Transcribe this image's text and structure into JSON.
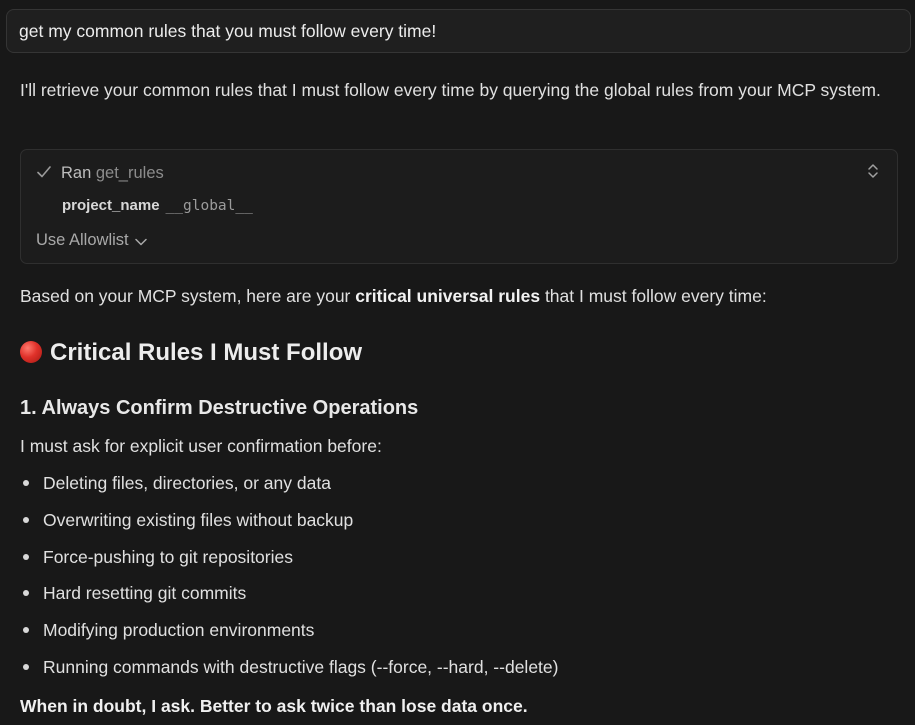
{
  "user_prompt": "get my common rules that you must follow every time!",
  "intro_text": "I'll retrieve your common rules that I must follow every time by querying the global rules from your MCP system.",
  "tool_call": {
    "status_label": "Ran",
    "tool_name": "get_rules",
    "param_key": "project_name",
    "param_value": "__global__",
    "allowlist_label": "Use Allowlist"
  },
  "summary": {
    "before": "Based on your MCP system, here are your ",
    "bold": "critical universal rules",
    "after": " that I must follow every time:"
  },
  "heading": "Critical Rules I Must Follow",
  "rule1": {
    "title": "1. Always Confirm Destructive Operations",
    "lead": "I must ask for explicit user confirmation before:",
    "bullets": [
      "Deleting files, directories, or any data",
      "Overwriting existing files without backup",
      "Force-pushing to git repositories",
      "Hard resetting git commits",
      "Modifying production environments",
      "Running commands with destructive flags (--force, --hard, --delete)"
    ],
    "closing": "When in doubt, I ask. Better to ask twice than lose data once."
  },
  "icons": {
    "status": "checkmark-icon",
    "expand": "expand-collapse-icon",
    "dropdown": "chevron-down-icon",
    "heading": "red-circle-emoji"
  }
}
